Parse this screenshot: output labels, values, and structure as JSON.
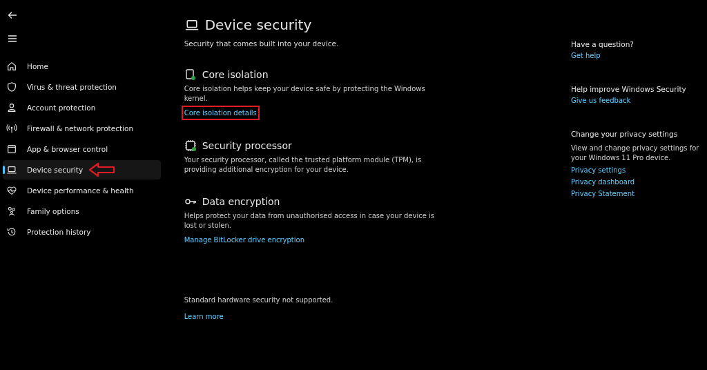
{
  "nav": {
    "items": [
      {
        "label": "Home",
        "kind": "home",
        "selected": false,
        "arrow_marked": false
      },
      {
        "label": "Virus & threat protection",
        "kind": "shield",
        "selected": false,
        "arrow_marked": false
      },
      {
        "label": "Account protection",
        "kind": "person",
        "selected": false,
        "arrow_marked": false
      },
      {
        "label": "Firewall & network protection",
        "kind": "antenna",
        "selected": false,
        "arrow_marked": false
      },
      {
        "label": "App & browser control",
        "kind": "window",
        "selected": false,
        "arrow_marked": false
      },
      {
        "label": "Device security",
        "kind": "laptop",
        "selected": true,
        "arrow_marked": true
      },
      {
        "label": "Device performance & health",
        "kind": "heart",
        "selected": false,
        "arrow_marked": false
      },
      {
        "label": "Family options",
        "kind": "family",
        "selected": false,
        "arrow_marked": false
      },
      {
        "label": "Protection history",
        "kind": "history",
        "selected": false,
        "arrow_marked": false
      }
    ]
  },
  "page": {
    "title": "Device security",
    "subtitle": "Security that comes built into your device.",
    "sections": [
      {
        "kind": "chip-check",
        "heading": "Core isolation",
        "text": "Core isolation helps keep your device safe by protecting the Windows kernel.",
        "link": {
          "label": "Core isolation details",
          "highlighted": true
        }
      },
      {
        "kind": "chip",
        "heading": "Security processor",
        "text": "Your security processor, called the trusted platform module (TPM), is providing additional encryption for your device."
      },
      {
        "kind": "key",
        "heading": "Data encryption",
        "text": "Helps protect your data from unauthorised access in case your device is lost or stolen.",
        "link": {
          "label": "Manage BitLocker drive encryption",
          "highlighted": false
        }
      }
    ],
    "footer": {
      "text": "Standard hardware security not supported.",
      "link": "Learn more"
    }
  },
  "aside": {
    "groups": [
      {
        "heading": "Have a question?",
        "links": [
          "Get help"
        ]
      },
      {
        "heading": "Help improve Windows Security",
        "links": [
          "Give us feedback"
        ]
      },
      {
        "heading": "Change your privacy settings",
        "text": "View and change privacy settings for your Windows 11 Pro device.",
        "links": [
          "Privacy settings",
          "Privacy dashboard",
          "Privacy Statement"
        ]
      }
    ]
  }
}
